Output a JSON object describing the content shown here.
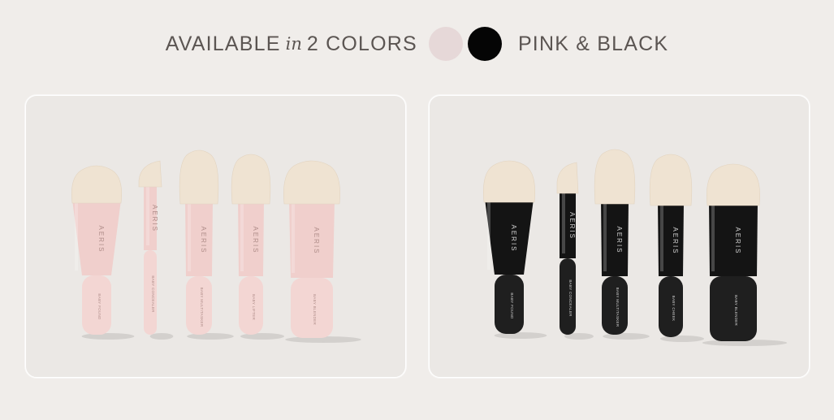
{
  "header": {
    "prefix": "AVAILABLE",
    "italic": "in",
    "middle": "2 COLORS",
    "suffix": "PINK & BLACK"
  },
  "swatches": [
    {
      "name": "pink",
      "color": "#e6d8d8"
    },
    {
      "name": "black",
      "color": "#050505"
    }
  ],
  "colors": {
    "background": "#f0edea",
    "text": "#5b5552",
    "bristle": "#efe3d2",
    "pink_handle": "#f0cfcc",
    "black_handle": "#141414"
  },
  "brand": "AERIS",
  "pink_brushes": [
    "BABY FOUND",
    "BABY CONCEALER",
    "BABY MULTITASKER",
    "BABY LIFTER",
    "BABY BLENDER"
  ],
  "black_brushes": [
    "BABY FOUND",
    "BABY CONCEALER",
    "BABY MULTITASKER",
    "BABY CHEEK",
    "BABY BLENDER"
  ]
}
